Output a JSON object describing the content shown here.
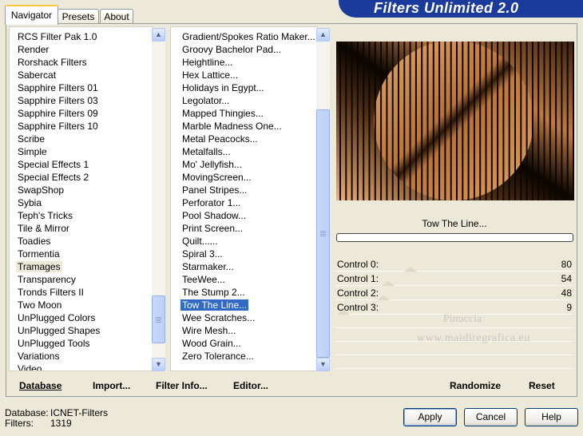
{
  "app_title": "Filters Unlimited 2.0",
  "tabs": [
    "Navigator",
    "Presets",
    "About"
  ],
  "categories": [
    "RCS Filter Pak 1.0",
    "Render",
    "Rorshack Filters",
    "Sabercat",
    "Sapphire Filters 01",
    "Sapphire Filters 03",
    "Sapphire Filters 09",
    "Sapphire Filters 10",
    "Scribe",
    "Simple",
    "Special Effects 1",
    "Special Effects 2",
    "SwapShop",
    "Sybia",
    "Teph's Tricks",
    "Tile & Mirror",
    "Toadies",
    "Tormentia",
    "Tramages",
    "Transparency",
    "Tronds Filters II",
    "Two Moon",
    "UnPlugged Colors",
    "UnPlugged Shapes",
    "UnPlugged Tools",
    "Variations",
    "Video"
  ],
  "selected_category": "Tramages",
  "filters": [
    "Gradient/Spokes Ratio Maker...",
    "Groovy Bachelor Pad...",
    "Heightline...",
    "Hex Lattice...",
    "Holidays in Egypt...",
    "Legolator...",
    "Mapped Thingies...",
    "Marble Madness One...",
    "Metal Peacocks...",
    "Metalfalls...",
    "Mo' Jellyfish...",
    "MovingScreen...",
    "Panel Stripes...",
    "Perforator 1...",
    "Pool Shadow...",
    "Print Screen...",
    "Quilt......",
    "Spiral 3...",
    "Starmaker...",
    "TeeWee...",
    "The Stump 2...",
    "Tow The Line...",
    "Wee Scratches...",
    "Wire Mesh...",
    "Wood Grain...",
    "Zero Tolerance..."
  ],
  "selected_filter": "Tow The Line...",
  "filter_name": "Tow The Line...",
  "controls": [
    {
      "label": "Control 0:",
      "value": "80"
    },
    {
      "label": "Control 1:",
      "value": "54"
    },
    {
      "label": "Control 2:",
      "value": "48"
    },
    {
      "label": "Control 3:",
      "value": "9"
    }
  ],
  "watermark": {
    "line1": "Pinuccia",
    "line2": "www.maidiregrafica.eu"
  },
  "bottom_links": {
    "database": "Database",
    "import": "Import...",
    "filter_info": "Filter Info...",
    "editor": "Editor...",
    "randomize": "Randomize",
    "reset": "Reset"
  },
  "status": {
    "database_label": "Database:",
    "database_value": "ICNET-Filters",
    "filters_label": "Filters:",
    "filters_value": "1319"
  },
  "buttons": {
    "apply": "Apply",
    "cancel": "Cancel",
    "help": "Help"
  },
  "icons": {
    "scroll_up": "scroll-up-icon",
    "scroll_down": "scroll-down-icon"
  },
  "colors": {
    "banner": "#1a3a9c",
    "selection": "#316ac5",
    "preview_orange": "#e8a060"
  }
}
